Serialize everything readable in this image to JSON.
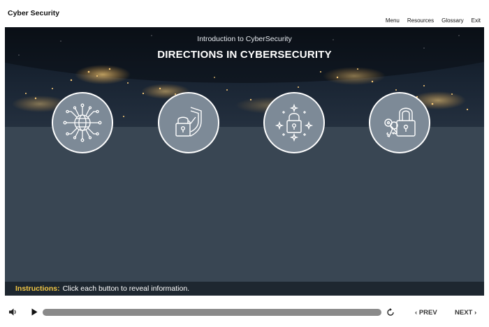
{
  "header": {
    "title": "Cyber Security",
    "nav": [
      "Menu",
      "Resources",
      "Glossary",
      "Exit"
    ]
  },
  "slide": {
    "subtitle": "Introduction to CyberSecurity",
    "title": "DIRECTIONS IN CYBERSECURITY",
    "buttons": [
      {
        "icon": "network-globe-icon"
      },
      {
        "icon": "shield-padlock-icon"
      },
      {
        "icon": "sparkling-padlock-icon"
      },
      {
        "icon": "keys-padlock-icon"
      }
    ],
    "instructions": {
      "label": "Instructions:",
      "text": "Click each button to reveal information."
    }
  },
  "player": {
    "prev_label": "PREV",
    "next_label": "NEXT",
    "progress": 0.0
  },
  "colors": {
    "stage_bg": "#394653",
    "instructions_bg": "#1e2730",
    "instructions_label": "#f2c744",
    "button_fill": "#7d8a97"
  }
}
